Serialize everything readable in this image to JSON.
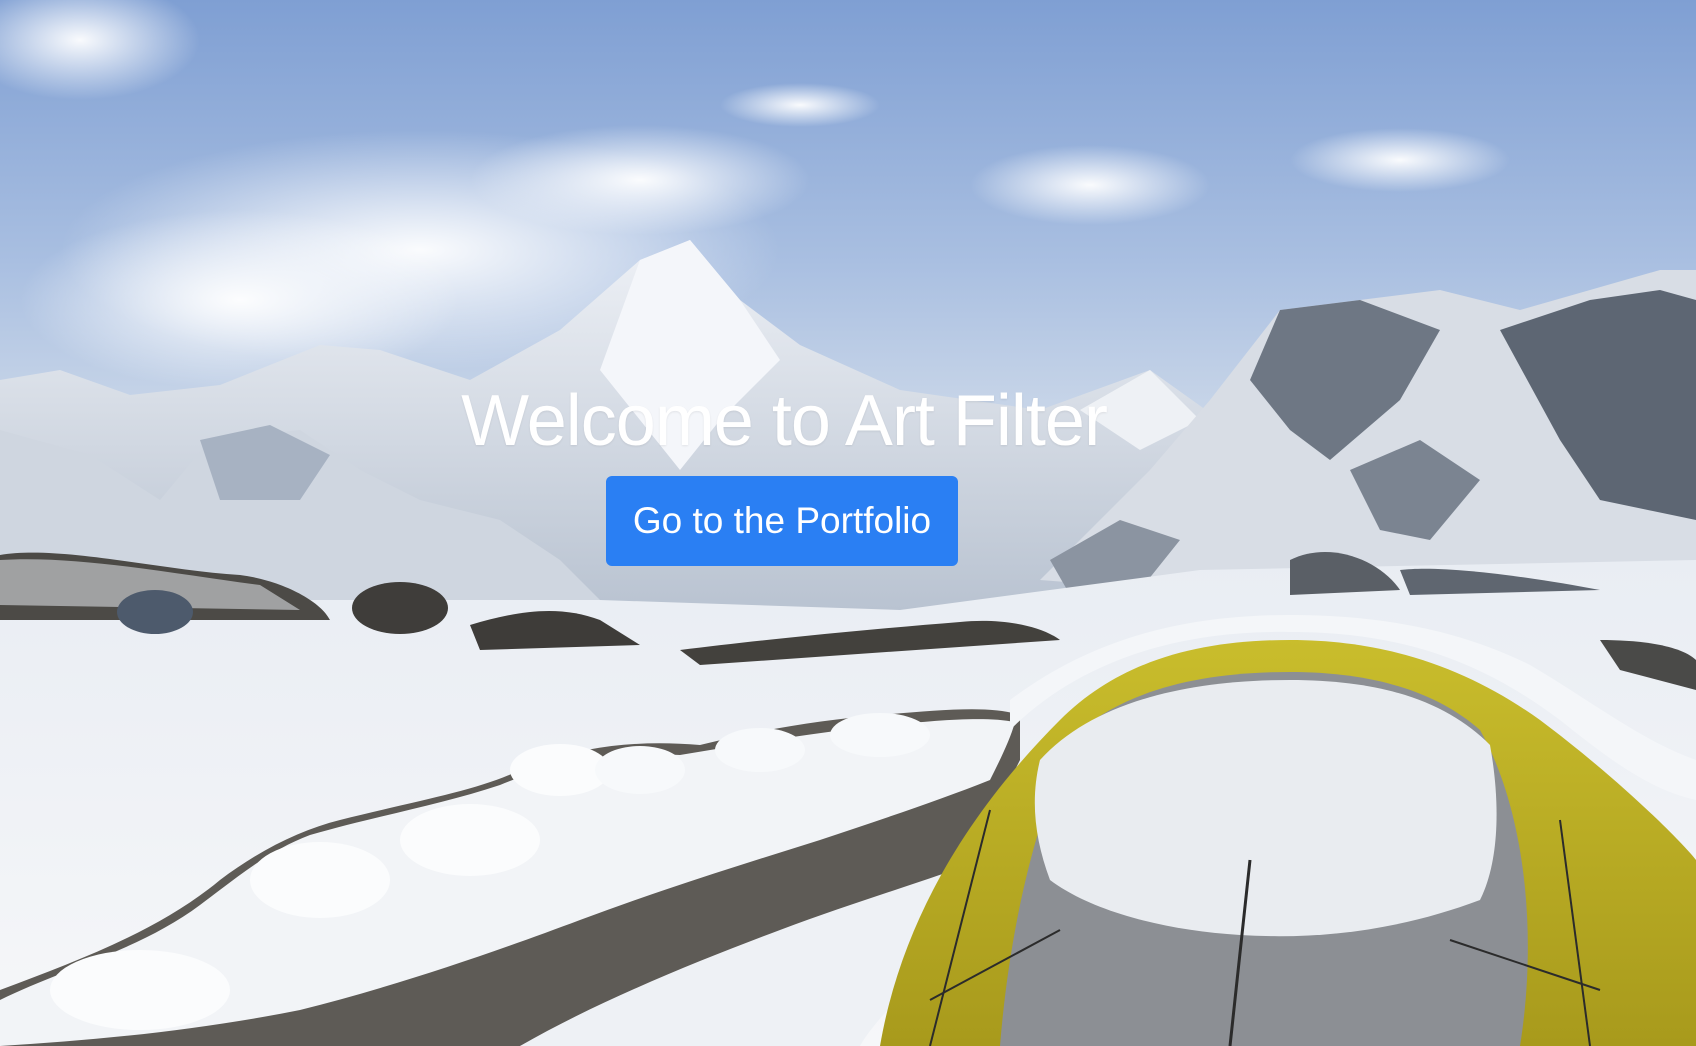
{
  "hero": {
    "title": "Welcome to Art Filter",
    "button_label": "Go to the Portfolio",
    "background_image": "snowy-mountain-camp-photo"
  },
  "colors": {
    "button": "#2a7ff3",
    "title_text": "#ffffff"
  }
}
